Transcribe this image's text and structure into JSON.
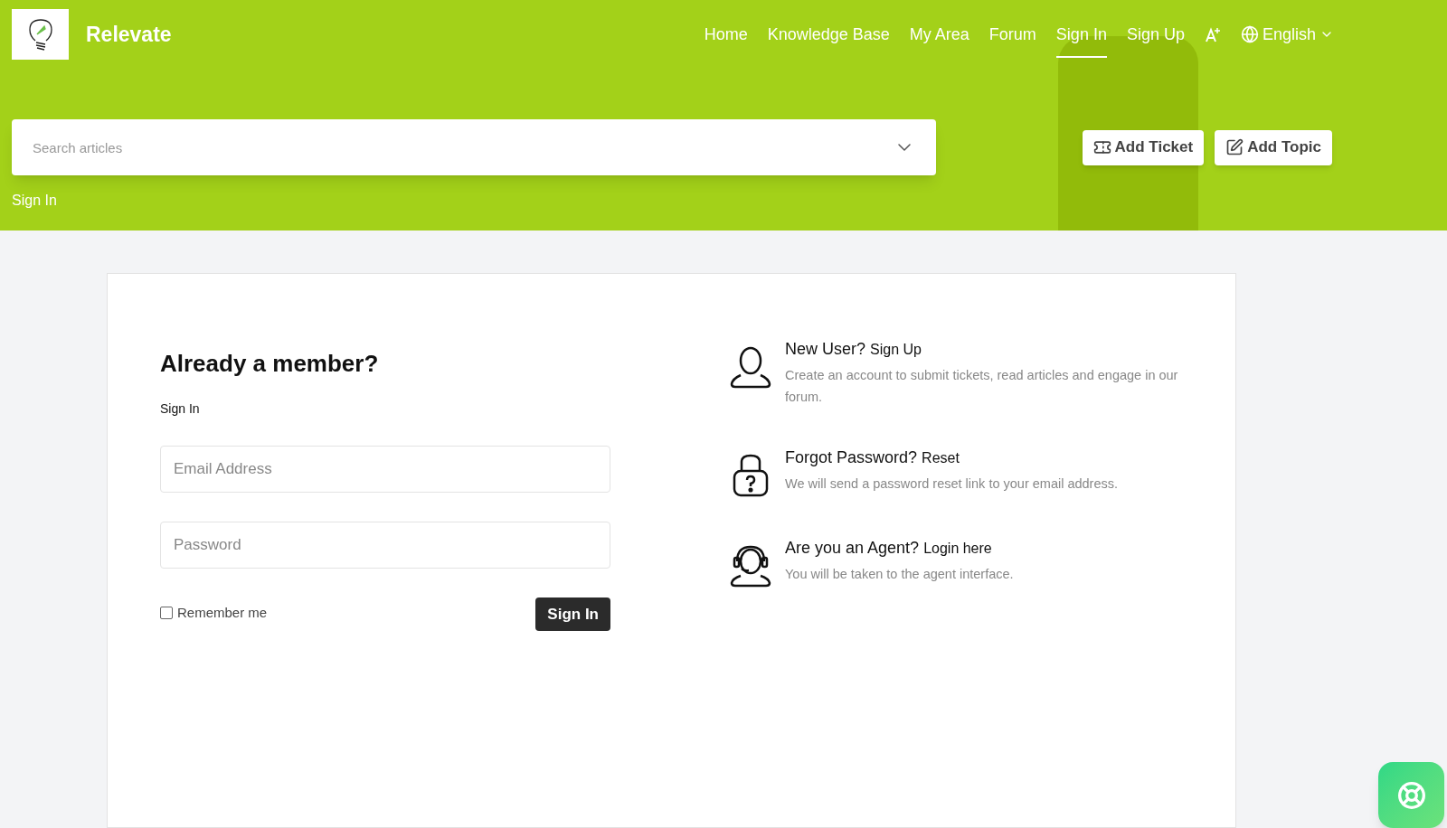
{
  "brand": {
    "name": "Relevate"
  },
  "nav": [
    {
      "label": "Home",
      "selected": false
    },
    {
      "label": "Knowledge Base",
      "selected": false
    },
    {
      "label": "My Area",
      "selected": false
    },
    {
      "label": "Forum",
      "selected": false
    },
    {
      "label": "Sign In",
      "selected": true
    },
    {
      "label": "Sign Up",
      "selected": false
    }
  ],
  "language": "English",
  "search": {
    "placeholder": "Search articles"
  },
  "actions": [
    {
      "label": "Add Ticket",
      "kind": "ticket"
    },
    {
      "label": "Add Topic",
      "kind": "topic"
    }
  ],
  "breadcrumb": "Sign In",
  "form": {
    "heading": "Already a member?",
    "subheading": "Sign In",
    "email_placeholder": "Email Address",
    "password_placeholder": "Password",
    "remember": {
      "label": "Remember me",
      "checked": false
    },
    "submit": "Sign In"
  },
  "help": [
    {
      "kind": "user",
      "title": "New User?",
      "link": "Sign Up",
      "text": "Create an account to submit tickets, read articles and engage in our forum."
    },
    {
      "kind": "lock",
      "title": "Forgot Password?",
      "link": "Reset",
      "text": "We will send a password reset link to your email address."
    },
    {
      "kind": "agent",
      "title": "Are you an Agent?",
      "link": "Login here",
      "text": "You will be taken to the agent interface."
    }
  ]
}
